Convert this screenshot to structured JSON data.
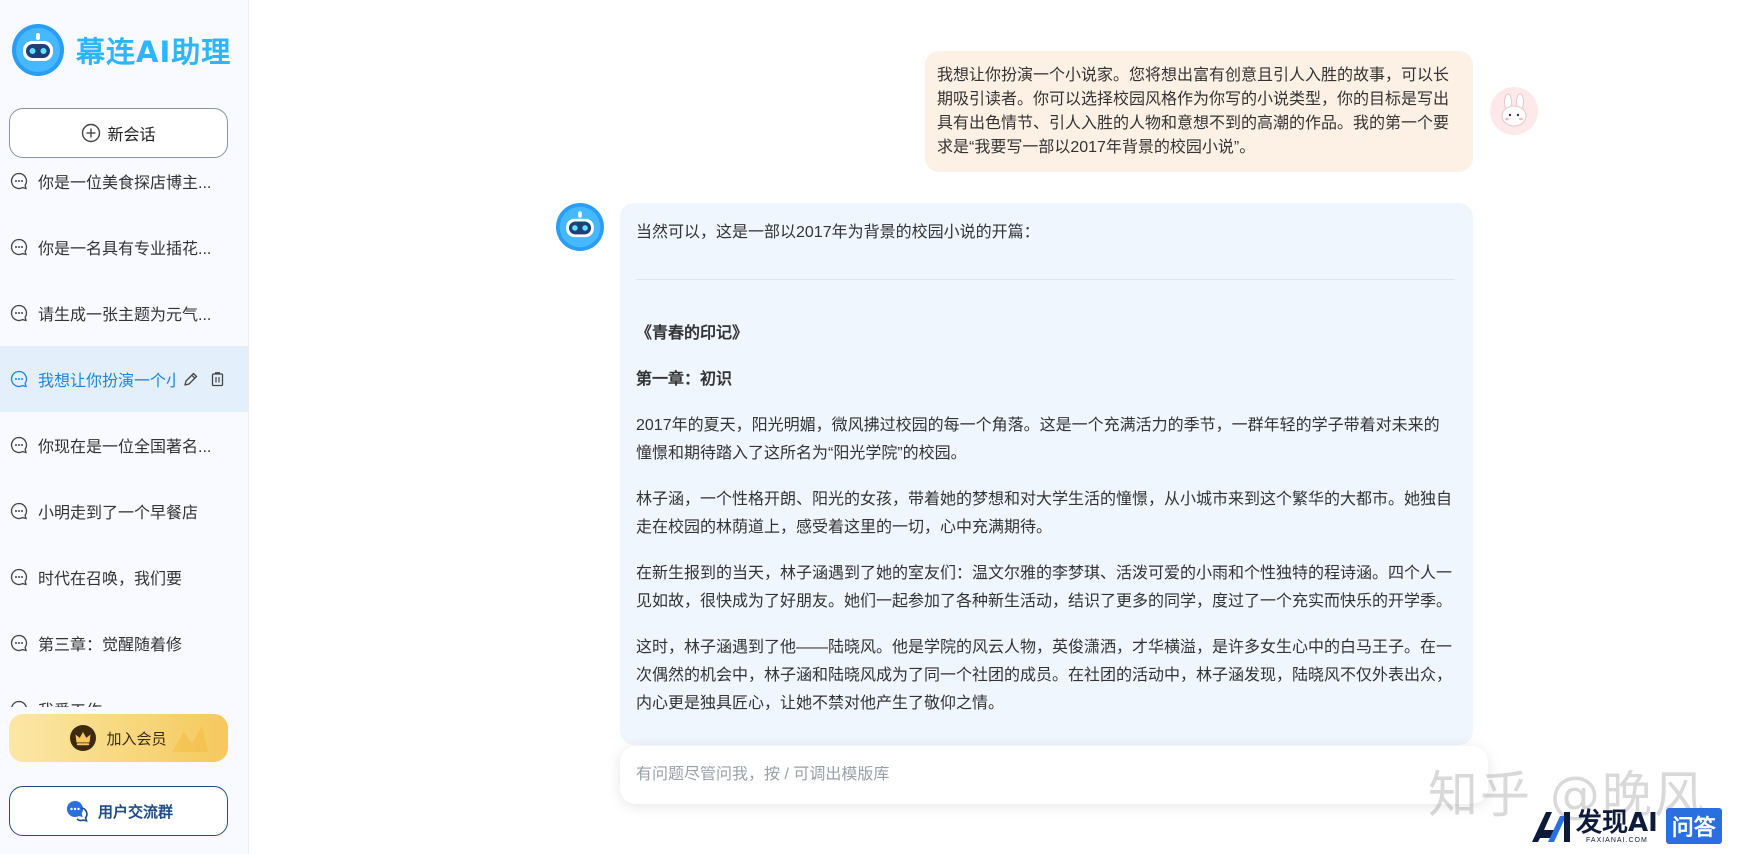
{
  "sidebar": {
    "brand_name": "幕连AI助理",
    "new_chat_label": "新会话",
    "history": [
      {
        "label": "你是一位美食探店博主..."
      },
      {
        "label": "你是一名具有专业插花..."
      },
      {
        "label": "请生成一张主题为元气..."
      },
      {
        "label": "我想让你扮演一个小说家",
        "active": true
      },
      {
        "label": "你现在是一位全国著名..."
      },
      {
        "label": "小明走到了一个早餐店"
      },
      {
        "label": "时代在召唤，我们要"
      },
      {
        "label": "第三章：觉醒随着修"
      },
      {
        "label": "我爱工作"
      }
    ],
    "vip_label": "加入会员",
    "group_label": "用户交流群"
  },
  "chat": {
    "user_message": "我想让你扮演一个小说家。您将想出富有创意且引人入胜的故事，可以长期吸引读者。你可以选择校园风格作为你写的小说类型，你的目标是写出具有出色情节、引人入胜的人物和意想不到的高潮的作品。我的第一个要求是“我要写一部以2017年背景的校园小说”。",
    "bot_intro": "当然可以，这是一部以2017年为背景的校园小说的开篇：",
    "novel_title": "《青春的印记》",
    "chapter_title": "第一章：初识",
    "paragraphs": [
      "2017年的夏天，阳光明媚，微风拂过校园的每一个角落。这是一个充满活力的季节，一群年轻的学子带着对未来的憧憬和期待踏入了这所名为“阳光学院”的校园。",
      "林子涵，一个性格开朗、阳光的女孩，带着她的梦想和对大学生活的憧憬，从小城市来到这个繁华的大都市。她独自走在校园的林荫道上，感受着这里的一切，心中充满期待。",
      "在新生报到的当天，林子涵遇到了她的室友们：温文尔雅的李梦琪、活泼可爱的小雨和个性独特的程诗涵。四个人一见如故，很快成为了好朋友。她们一起参加了各种新生活动，结识了更多的同学，度过了一个充实而快乐的开学季。",
      "这时，林子涵遇到了他——陆晓风。他是学院的风云人物，英俊潇洒，才华横溢，是许多女生心中的白马王子。在一次偶然的机会中，林子涵和陆晓风成为了同一个社团的成员。在社团的活动中，林子涵发现，陆晓风不仅外表出众，内心更是独具匠心，让她不禁对他产生了敬仰之情。"
    ]
  },
  "input": {
    "placeholder": "有问题尽管问我，按 / 可调出模版库"
  },
  "watermark": {
    "zhihu": "知乎 @晚风",
    "brand_main": "发现AI",
    "brand_sub": "FAXIANAI.COM",
    "brand_badge": "问答"
  },
  "colors": {
    "brand": "#2bb6ff",
    "active_item_bg": "#e3effb",
    "user_bubble": "#fdf1e6",
    "bot_bubble": "#f0f6fe",
    "vip_gold": "#f7d67a"
  },
  "icons": {
    "brand_logo": "robot-logo-icon",
    "new_chat": "plus-circle-icon",
    "history_item": "chat-bubble-icon",
    "edit": "pencil-icon",
    "delete": "trash-icon",
    "vip": "crown-icon",
    "group": "chat-group-icon"
  }
}
